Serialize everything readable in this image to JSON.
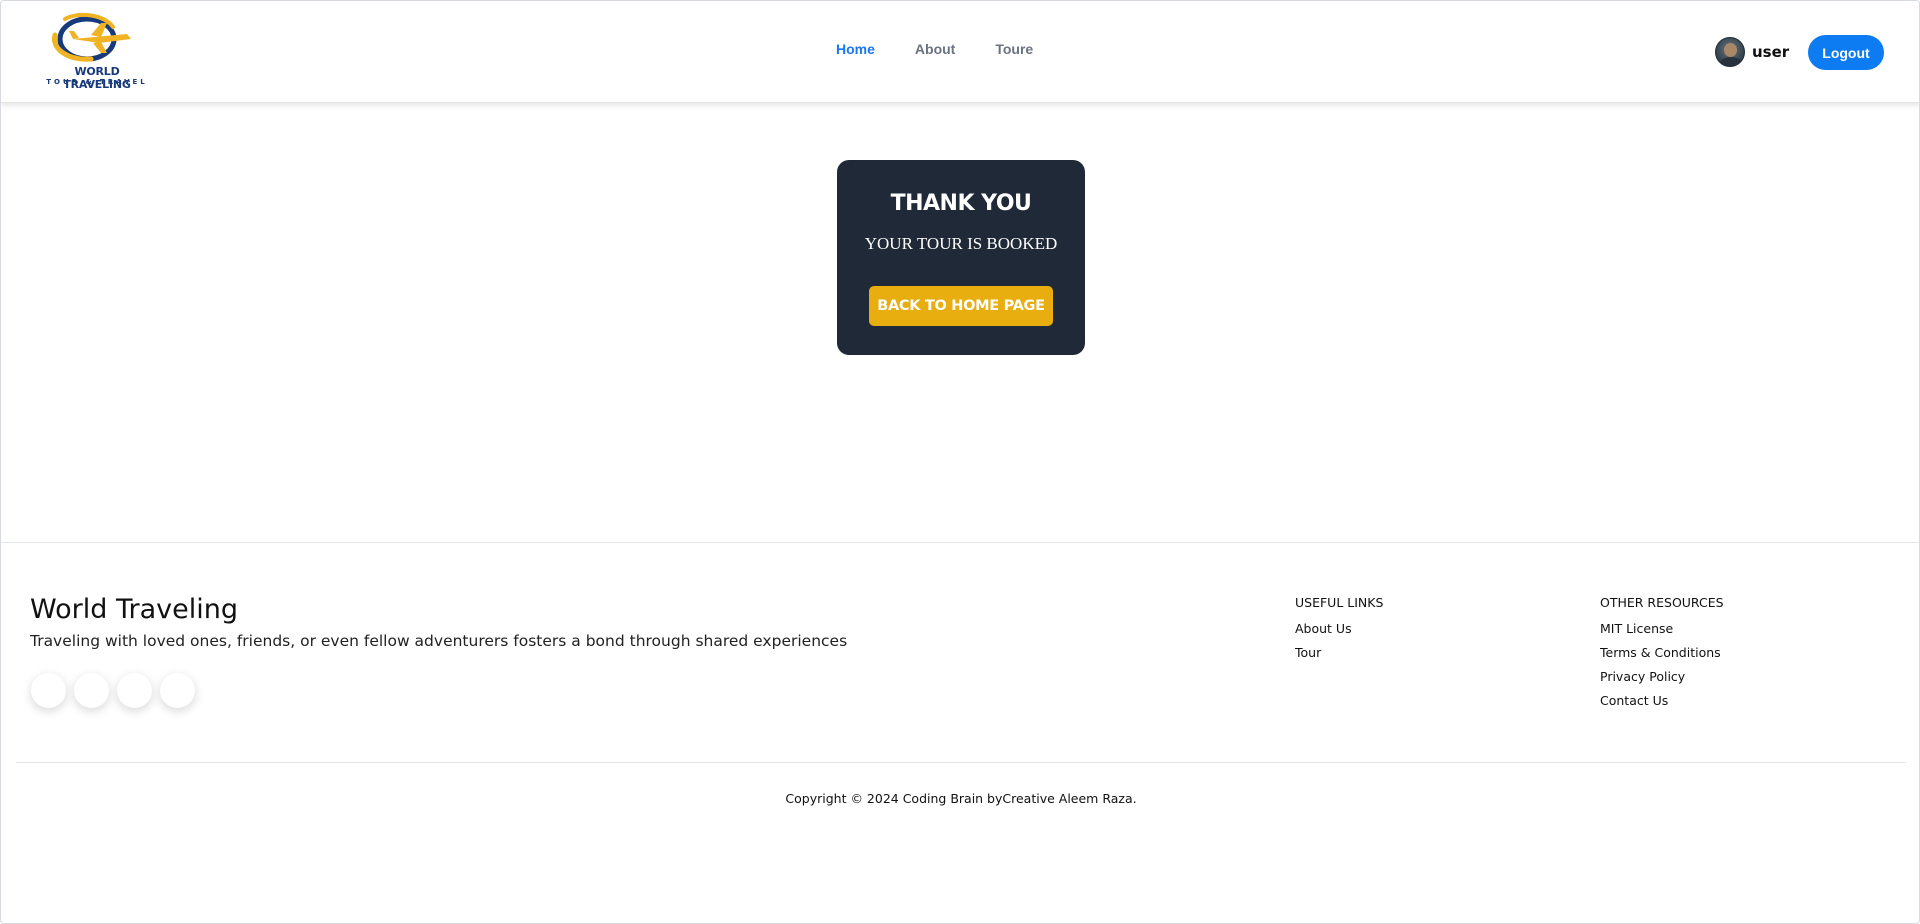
{
  "header": {
    "logo": {
      "line1": "WORLD TRAVELING",
      "line2": "TOUR & TRAVEL",
      "accent_color": "#f0b323",
      "brand_color": "#173a7a"
    },
    "nav": [
      {
        "label": "Home",
        "active": true
      },
      {
        "label": "About",
        "active": false
      },
      {
        "label": "Toure",
        "active": false
      }
    ],
    "user": {
      "name": "user",
      "avatar_icon": "user-avatar"
    },
    "logout_label": "Logout",
    "accent_blue": "#0d7bf2"
  },
  "confirmation": {
    "title": "THANK YOU",
    "subtitle": "YOUR TOUR IS BOOKED",
    "button_label": "BACK TO HOME PAGE",
    "card_color": "#1f2937",
    "button_color": "#e8ad0f"
  },
  "footer": {
    "title": "World Traveling",
    "description": "Traveling with loved ones, friends, or even fellow adventurers fosters a bond through shared experiences",
    "social_icons": [
      "social-icon-1",
      "social-icon-2",
      "social-icon-3",
      "social-icon-4"
    ],
    "useful_links": {
      "heading": "USEFUL LINKS",
      "items": [
        "About Us",
        "Tour"
      ]
    },
    "other_resources": {
      "heading": "OTHER RESOURCES",
      "items": [
        "MIT License",
        "Terms & Conditions",
        "Privacy Policy",
        "Contact Us"
      ]
    },
    "copyright": "Copyright © 2024 Coding Brain byCreative Aleem Raza."
  }
}
